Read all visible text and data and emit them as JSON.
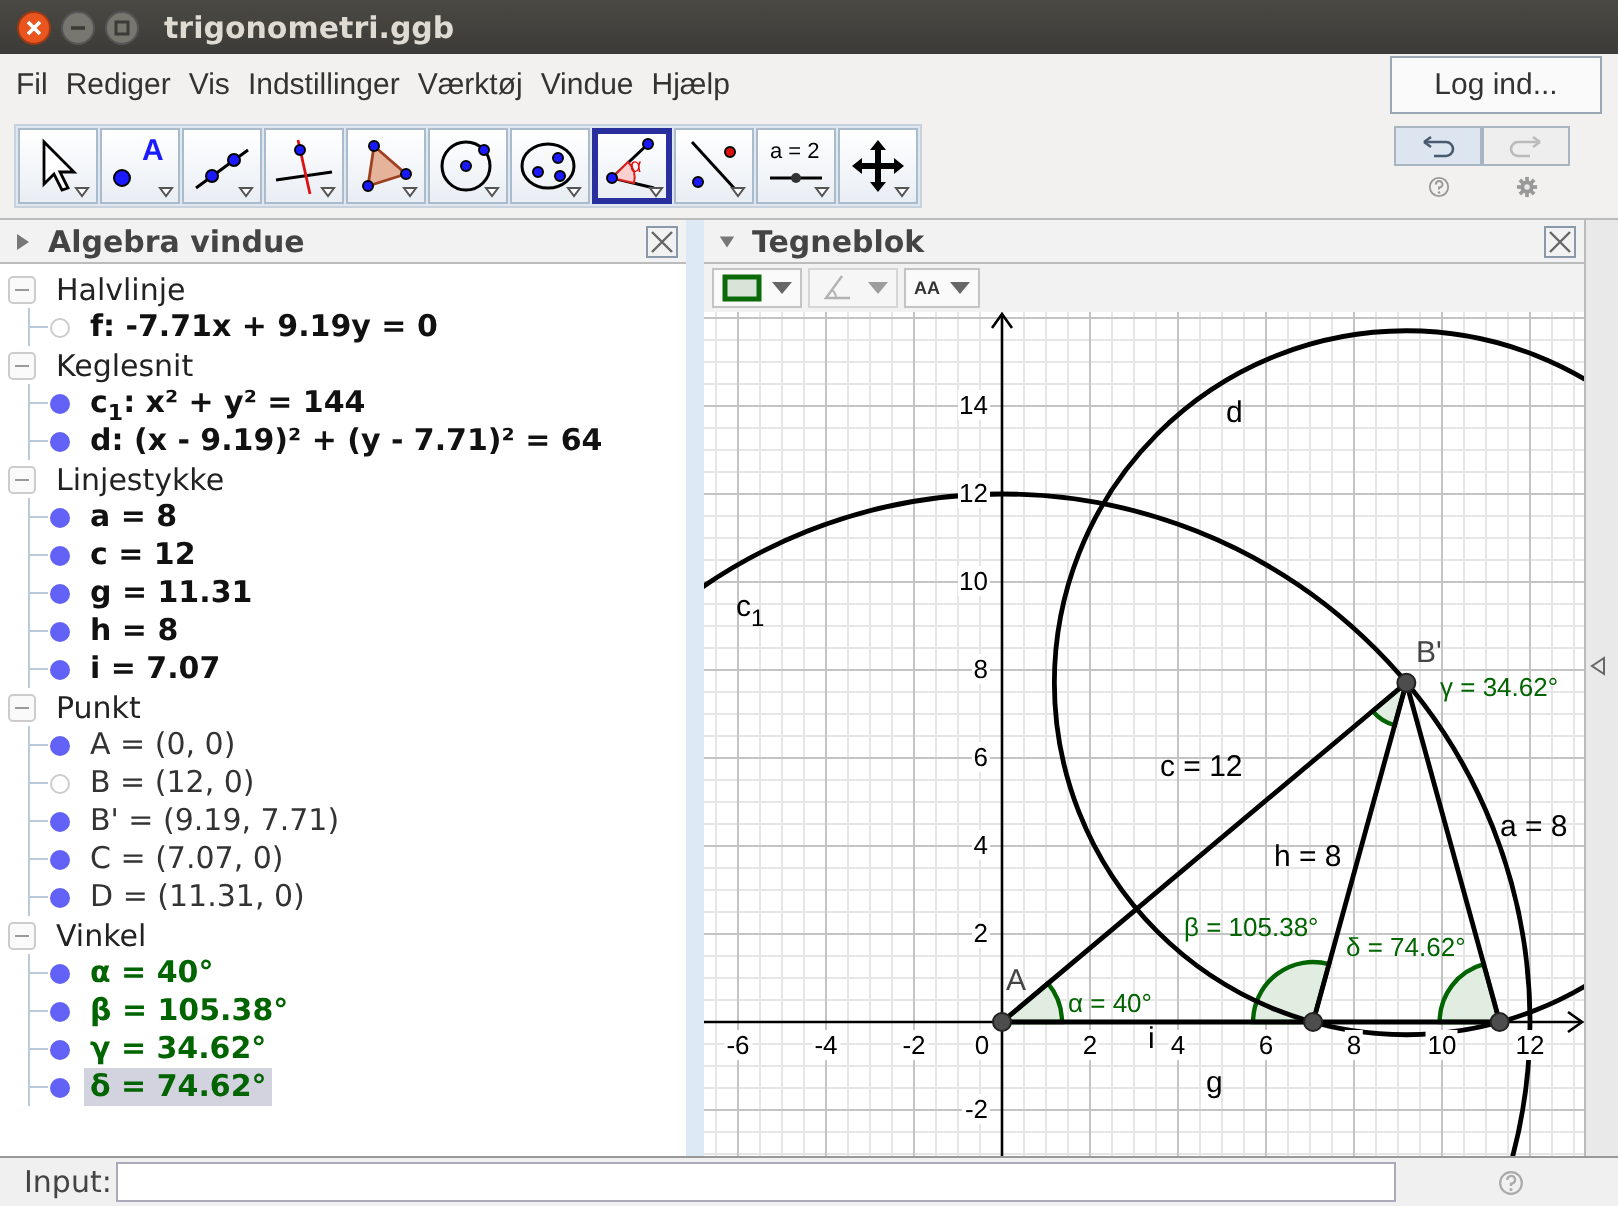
{
  "window": {
    "title": "trigonometri.ggb"
  },
  "menu": [
    "Fil",
    "Rediger",
    "Vis",
    "Indstillinger",
    "Værktøj",
    "Vindue",
    "Hjælp"
  ],
  "login_button": "Log ind...",
  "toolbar": {
    "tools": [
      {
        "kind": "move",
        "selected": false
      },
      {
        "kind": "point",
        "label": "A",
        "selected": false
      },
      {
        "kind": "line",
        "selected": false
      },
      {
        "kind": "perpendicular",
        "selected": false
      },
      {
        "kind": "polygon",
        "selected": false
      },
      {
        "kind": "circle",
        "selected": false
      },
      {
        "kind": "conic",
        "selected": false
      },
      {
        "kind": "angle",
        "label": "α",
        "selected": true
      },
      {
        "kind": "reflect",
        "selected": false
      },
      {
        "kind": "slider",
        "label": "a = 2",
        "selected": false
      },
      {
        "kind": "move_view",
        "selected": false
      }
    ],
    "undo_disabled": false,
    "redo_disabled": true
  },
  "algebra_view": {
    "title": "Algebra vindue",
    "categories": [
      {
        "label": "Halvlinje",
        "expanded": true,
        "items": [
          {
            "text": "f: -7.71x + 9.19y = 0",
            "kind": "object",
            "visible": false,
            "selected": false
          }
        ]
      },
      {
        "label": "Keglesnit",
        "expanded": true,
        "items": [
          {
            "text": "c$_{1}$: x² + y² = 144",
            "kind": "object",
            "visible": true,
            "selected": false
          },
          {
            "text": "d: (x - 9.19)² + (y - 7.71)² = 64",
            "kind": "object",
            "visible": true,
            "selected": false
          }
        ]
      },
      {
        "label": "Linjestykke",
        "expanded": true,
        "items": [
          {
            "text": "a = 8",
            "kind": "object",
            "visible": true,
            "selected": false
          },
          {
            "text": "c = 12",
            "kind": "object",
            "visible": true,
            "selected": false
          },
          {
            "text": "g = 11.31",
            "kind": "object",
            "visible": true,
            "selected": false
          },
          {
            "text": "h = 8",
            "kind": "object",
            "visible": true,
            "selected": false
          },
          {
            "text": "i = 7.07",
            "kind": "object",
            "visible": true,
            "selected": false
          }
        ]
      },
      {
        "label": "Punkt",
        "expanded": true,
        "items": [
          {
            "text": "A = (0, 0)",
            "kind": "point",
            "visible": true,
            "selected": false
          },
          {
            "text": "B = (12, 0)",
            "kind": "point",
            "visible": false,
            "selected": false
          },
          {
            "text": "B' = (9.19, 7.71)",
            "kind": "point",
            "visible": true,
            "selected": false
          },
          {
            "text": "C = (7.07, 0)",
            "kind": "point",
            "visible": true,
            "selected": false
          },
          {
            "text": "D = (11.31, 0)",
            "kind": "point",
            "visible": true,
            "selected": false
          }
        ]
      },
      {
        "label": "Vinkel",
        "expanded": true,
        "items": [
          {
            "text": "α = 40°",
            "kind": "angle",
            "visible": true,
            "selected": false
          },
          {
            "text": "β = 105.38°",
            "kind": "angle",
            "visible": true,
            "selected": false
          },
          {
            "text": "γ = 34.62°",
            "kind": "angle",
            "visible": true,
            "selected": false
          },
          {
            "text": "δ = 74.62°",
            "kind": "angle",
            "visible": true,
            "selected": true
          }
        ]
      }
    ]
  },
  "graphics_view": {
    "title": "Tegneblok",
    "style_bar": [
      {
        "kind": "color",
        "disabled": false
      },
      {
        "kind": "line_style",
        "disabled": true
      },
      {
        "kind": "text_size",
        "label": "AA",
        "disabled": false
      }
    ],
    "x_tick_labels": [
      "-6",
      "-4",
      "-2",
      "0",
      "2",
      "4",
      "6",
      "8",
      "10",
      "12"
    ],
    "y_tick_labels": [
      "14",
      "12",
      "10",
      "8",
      "6",
      "4",
      "2",
      "-2"
    ],
    "labels": [
      {
        "text": "c$_{1}$",
        "kind": "object"
      },
      {
        "text": "d",
        "kind": "object"
      },
      {
        "text": "B'",
        "kind": "point"
      },
      {
        "text": "γ = 34.62°",
        "kind": "angle"
      },
      {
        "text": "c = 12",
        "kind": "object"
      },
      {
        "text": "h = 8",
        "kind": "object"
      },
      {
        "text": "a = 8",
        "kind": "object"
      },
      {
        "text": "A",
        "kind": "point"
      },
      {
        "text": "α = 40°",
        "kind": "angle"
      },
      {
        "text": "β = 105.38°",
        "kind": "angle"
      },
      {
        "text": "δ = 74.62°",
        "kind": "angle"
      },
      {
        "text": "i",
        "kind": "object"
      },
      {
        "text": "g",
        "kind": "object"
      }
    ]
  },
  "input_bar": {
    "label": "Input:"
  }
}
